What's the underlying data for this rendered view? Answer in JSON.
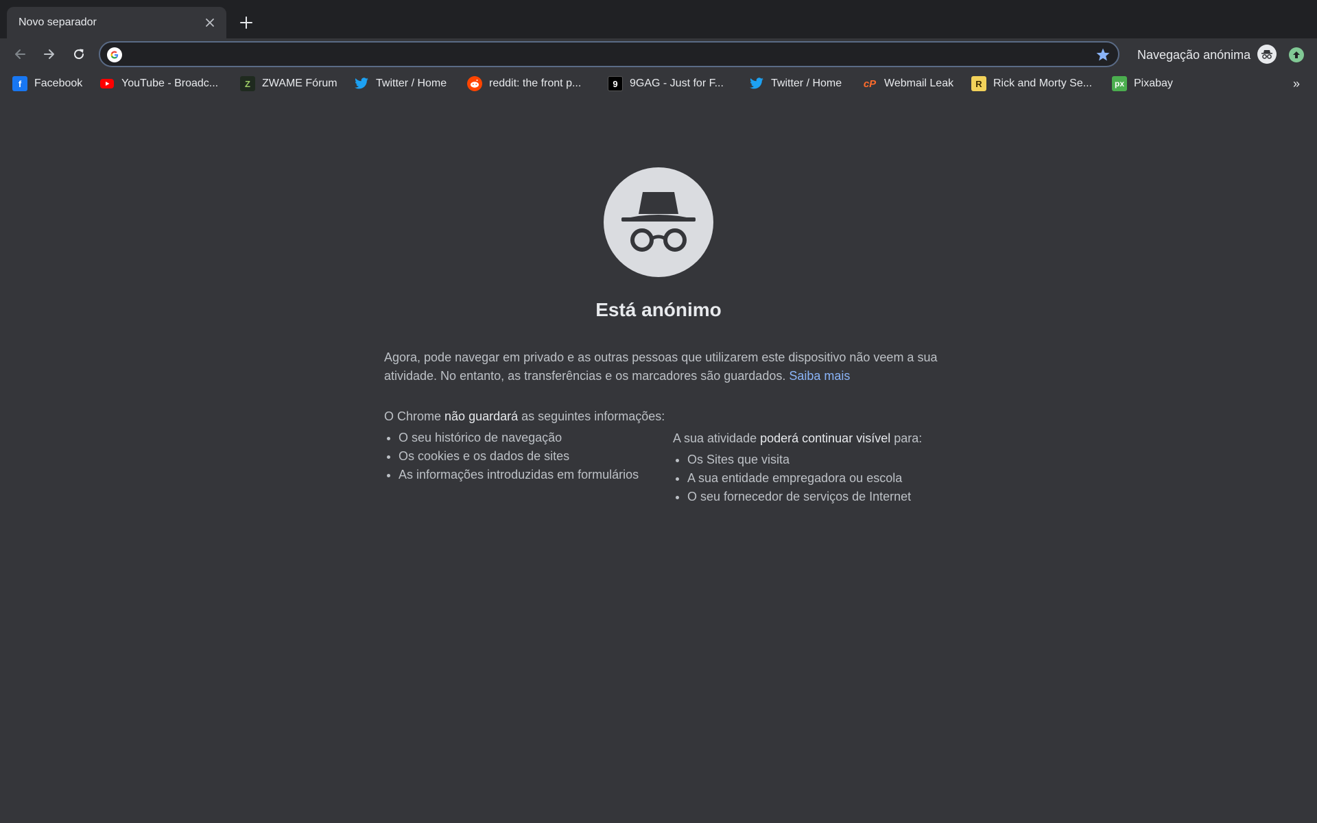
{
  "tab": {
    "title": "Novo separador"
  },
  "omnibox": {
    "value": "",
    "placeholder": ""
  },
  "toolbar": {
    "incognito_label": "Navegação anónima"
  },
  "bookmarks": [
    {
      "label": "Facebook",
      "icon": "facebook-icon",
      "color": "#1877f2"
    },
    {
      "label": "YouTube - Broadc...",
      "icon": "youtube-icon",
      "color": "#ff0000"
    },
    {
      "label": "ZWAME Fórum",
      "icon": "zwame-icon",
      "color": "#2b3a2b"
    },
    {
      "label": "Twitter / Home",
      "icon": "twitter-icon",
      "color": "#1da1f2"
    },
    {
      "label": "reddit: the front p...",
      "icon": "reddit-icon",
      "color": "#ff4500"
    },
    {
      "label": "9GAG - Just for F...",
      "icon": "9gag-icon",
      "color": "#000000"
    },
    {
      "label": "Twitter / Home",
      "icon": "twitter-icon",
      "color": "#1da1f2"
    },
    {
      "label": "Webmail Leak",
      "icon": "cpanel-icon",
      "color": "#ff6c2c"
    },
    {
      "label": "Rick and Morty Se...",
      "icon": "rick-and-morty-icon",
      "color": "#f2d25a"
    },
    {
      "label": "Pixabay",
      "icon": "pixabay-icon",
      "color": "#4bae4f"
    }
  ],
  "page": {
    "heading": "Está anónimo",
    "intro": "Agora, pode navegar em privado e as outras pessoas que utilizarem este dispositivo não veem a sua atividade. No entanto, as transferências e os marcadores são guardados.",
    "learn_more": "Saiba mais",
    "left": {
      "title_pre": "O Chrome ",
      "title_bold": "não guardará",
      "title_post": " as seguintes informações:",
      "items": [
        "O seu histórico de navegação",
        "Os cookies e os dados de sites",
        "As informações introduzidas em formulários"
      ]
    },
    "right": {
      "title_pre": "A sua atividade ",
      "title_bold": "poderá continuar visível",
      "title_post": " para:",
      "items": [
        "Os Sites que visita",
        "A sua entidade empregadora ou escola",
        "O seu fornecedor de serviços de Internet"
      ]
    }
  },
  "colors": {
    "tabstrip": "#202124",
    "toolbar": "#35363a",
    "link": "#8ab4f8",
    "accent_star": "#8ab4f8"
  }
}
